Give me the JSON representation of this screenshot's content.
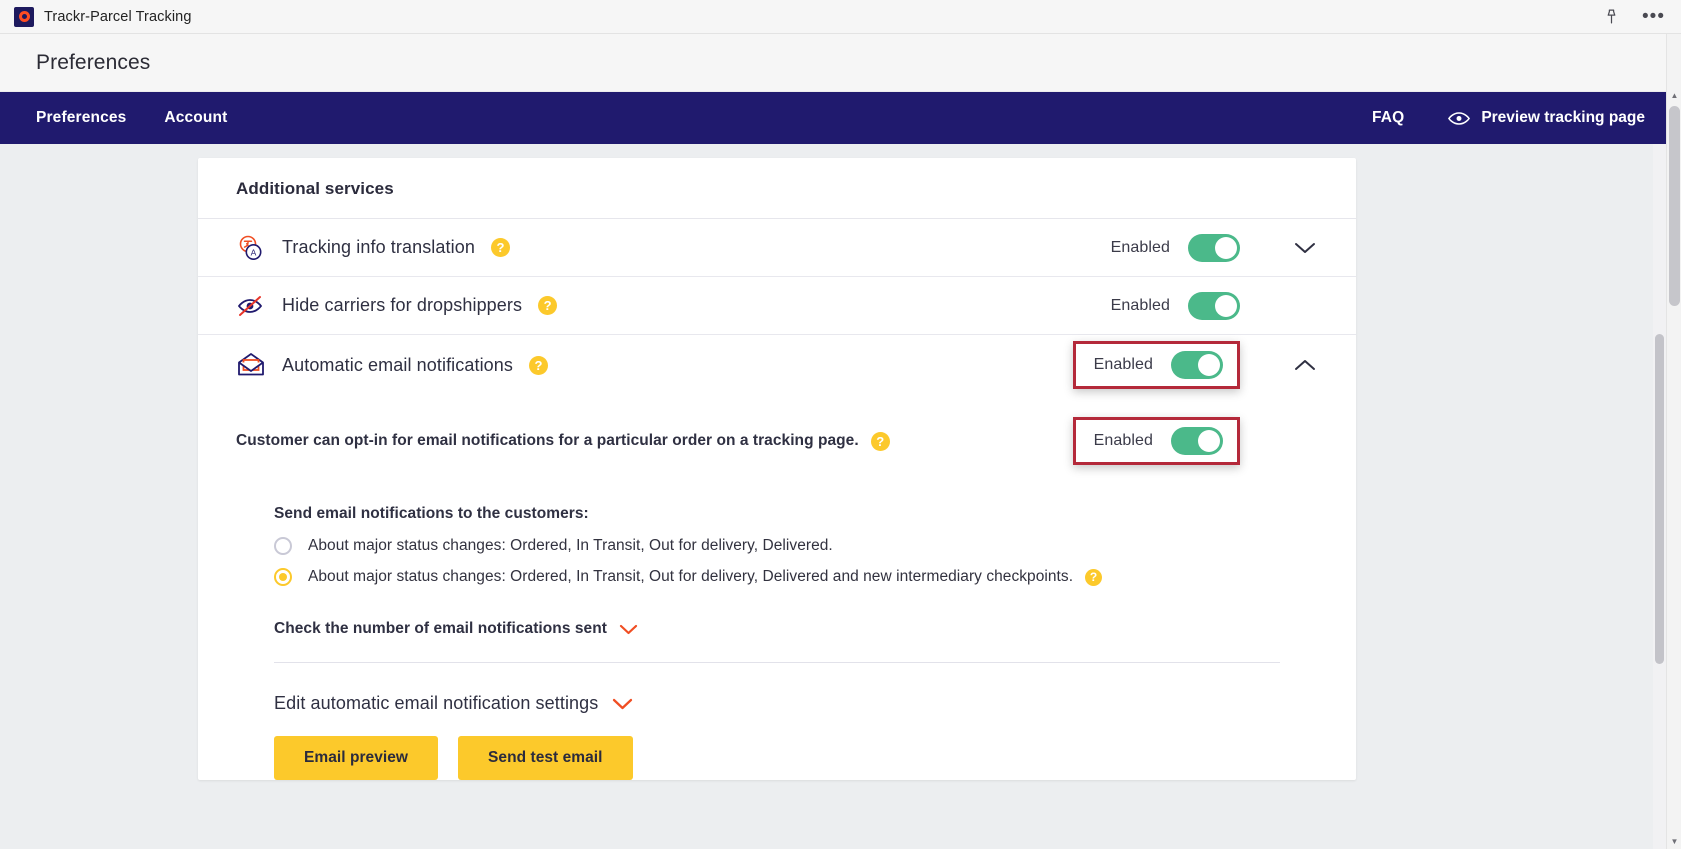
{
  "titlebar": {
    "app_name": "Trackr-Parcel Tracking",
    "pin_icon": "pin-icon",
    "more_icon": "more-options-icon"
  },
  "page": {
    "heading": "Preferences"
  },
  "navbar": {
    "items": [
      {
        "label": "Preferences",
        "active": true
      },
      {
        "label": "Account",
        "active": false
      }
    ],
    "faq_label": "FAQ",
    "preview_label": "Preview tracking page",
    "preview_icon": "eye-icon",
    "background": "#201a6e"
  },
  "card": {
    "title": "Additional services",
    "services": [
      {
        "icon": "translate-icon",
        "label": "Tracking info translation",
        "help": "?",
        "status": "Enabled",
        "toggle_on": true,
        "chevron": "chevron-down-icon",
        "highlighted": false
      },
      {
        "icon": "hidden-eye-icon",
        "label": "Hide carriers for dropshippers",
        "help": "?",
        "status": "Enabled",
        "toggle_on": true,
        "chevron": "",
        "highlighted": false
      },
      {
        "icon": "open-envelope-icon",
        "label": "Automatic email notifications",
        "help": "?",
        "status": "Enabled",
        "toggle_on": true,
        "chevron": "chevron-up-icon",
        "highlighted": true
      }
    ]
  },
  "panel": {
    "optin_text": "Customer can opt-in for email notifications for a particular order on a tracking page.",
    "optin_help": "?",
    "optin_status": "Enabled",
    "optin_toggle_on": true,
    "send_heading": "Send email notifications to the customers:",
    "options": [
      {
        "label": "About major status changes: Ordered, In Transit, Out for delivery, Delivered.",
        "selected": false,
        "help": ""
      },
      {
        "label": "About major status changes: Ordered, In Transit, Out for delivery, Delivered and new intermediary checkpoints.",
        "selected": true,
        "help": "?"
      }
    ],
    "check_count_label": "Check the number of email notifications sent",
    "check_count_icon": "chevron-down-icon",
    "edit_settings_label": "Edit automatic email notification settings",
    "edit_settings_icon": "chevron-down-icon",
    "buttons": [
      {
        "label": "Email preview"
      },
      {
        "label": "Send test email"
      }
    ]
  },
  "colors": {
    "navy": "#201a6e",
    "yellow": "#fcc92b",
    "green": "#4bb98a",
    "highlight_red": "#b4293a",
    "orange": "#f04e23"
  }
}
